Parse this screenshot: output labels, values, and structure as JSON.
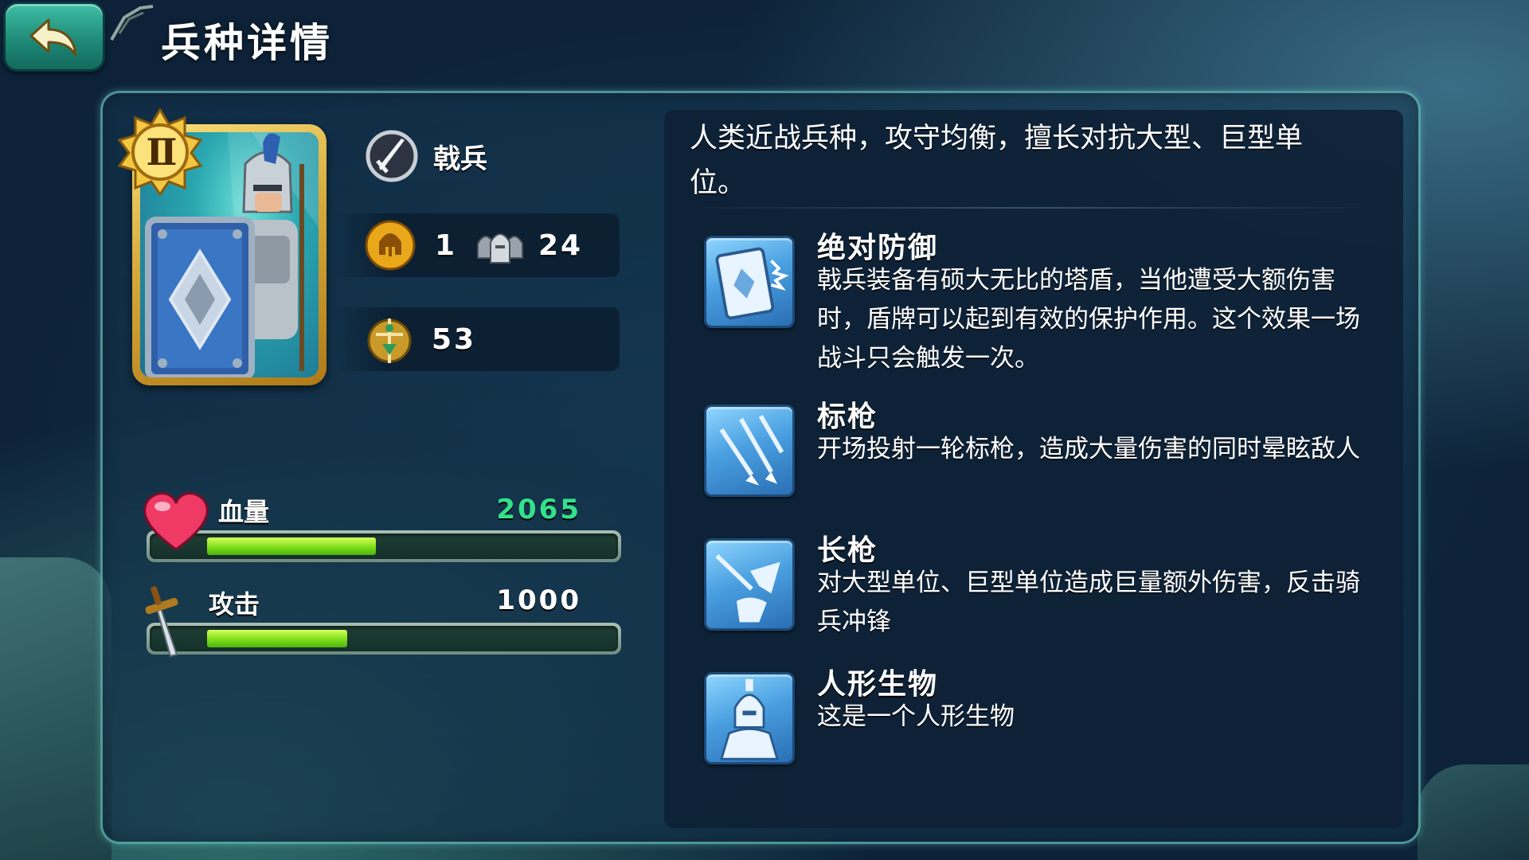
{
  "header": {
    "title": "兵种详情"
  },
  "unit": {
    "rank": "II",
    "type_name": "戟兵",
    "cost": "1",
    "count": "24",
    "power": "53",
    "description": "人类近战兵种，攻守均衡，擅长对抗大型、巨型单位。"
  },
  "stats": {
    "hp": {
      "label": "血量",
      "value": "2065",
      "value_color": "#34e08a",
      "fill_fraction": 0.36
    },
    "attack": {
      "label": "攻击",
      "value": "1000",
      "value_color": "#ffffff",
      "fill_fraction": 0.3
    }
  },
  "skills": [
    {
      "name": "绝对防御",
      "text": "戟兵装备有硕大无比的塔盾，当他遭受大额伤害时，盾牌可以起到有效的保护作用。这个效果一场战斗只会触发一次。",
      "icon": "tower-shield-icon"
    },
    {
      "name": "标枪",
      "text": "开场投射一轮标枪，造成大量伤害的同时晕眩敌人",
      "icon": "javelin-icon"
    },
    {
      "name": "长枪",
      "text": "对大型单位、巨型单位造成巨量额外伤害，反击骑兵冲锋",
      "icon": "long-spear-icon"
    },
    {
      "name": "人形生物",
      "text": "这是一个人形生物",
      "icon": "humanoid-icon"
    }
  ],
  "colors": {
    "accent_teal": "#1f8a78",
    "bar_green": "#7ede1b",
    "card_gold": "#d6a93a",
    "skill_blue": "#4aa0e0"
  }
}
